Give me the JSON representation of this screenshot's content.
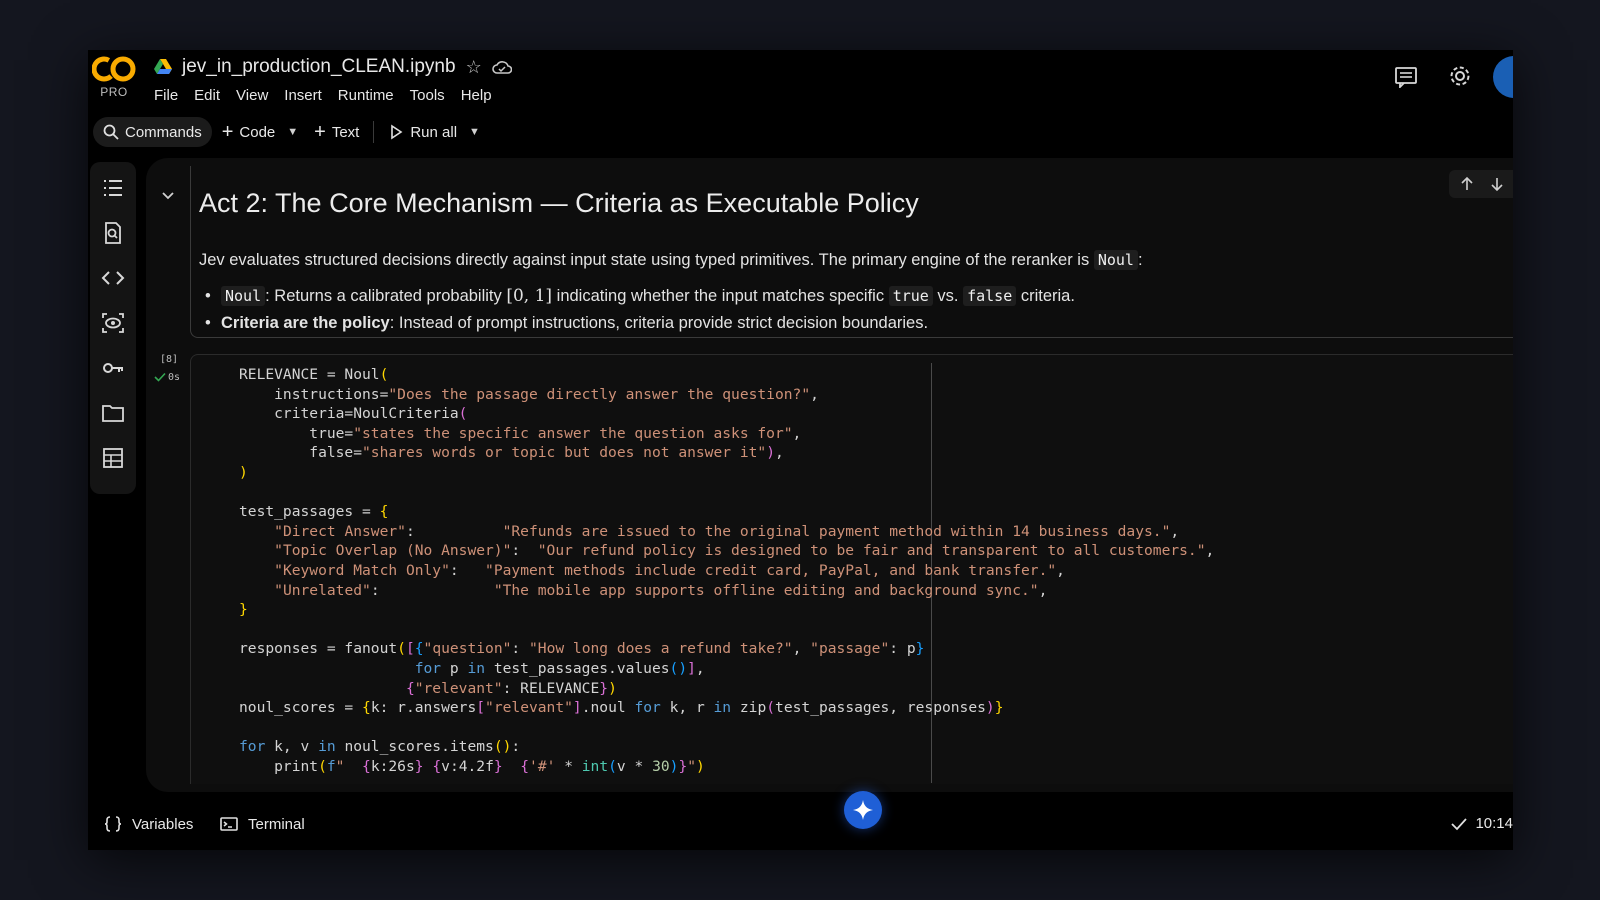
{
  "app": {
    "logo_text": "CO",
    "logo_tier": "PRO",
    "doc_title": "jev_in_production_CLEAN.ipynb"
  },
  "menu": [
    "File",
    "Edit",
    "View",
    "Insert",
    "Runtime",
    "Tools",
    "Help"
  ],
  "toolbar": {
    "commands_label": "Commands",
    "code_label": "Code",
    "text_label": "Text",
    "run_all_label": "Run all"
  },
  "markdown_cell": {
    "heading": "Act 2: The Core Mechanism — Criteria as Executable Policy",
    "para_prefix": "Jev evaluates structured decisions directly against input state using typed primitives. The primary engine of the reranker is",
    "para_code": "Noul",
    "para_suffix": ":",
    "bullet1_code": "Noul",
    "bullet1_a": ": Returns a calibrated probability",
    "bullet1_math": "[0, 1]",
    "bullet1_b": "indicating whether the input matches specific",
    "bullet1_true": "true",
    "bullet1_vs": "vs.",
    "bullet1_false": "false",
    "bullet1_c": "criteria.",
    "bullet2_bold": "Criteria are the policy",
    "bullet2_rest": ": Instead of prompt instructions, criteria provide strict decision boundaries."
  },
  "code_cell": {
    "exec_count": "[8]",
    "exec_time": "0s"
  },
  "bottombar": {
    "variables_label": "Variables",
    "terminal_label": "Terminal",
    "status_time": "10:14"
  },
  "colors": {
    "accent": "#1f5fd6",
    "logo_orange": "#f9ab00",
    "string": "#ce9178",
    "keyword": "#569cd6"
  }
}
